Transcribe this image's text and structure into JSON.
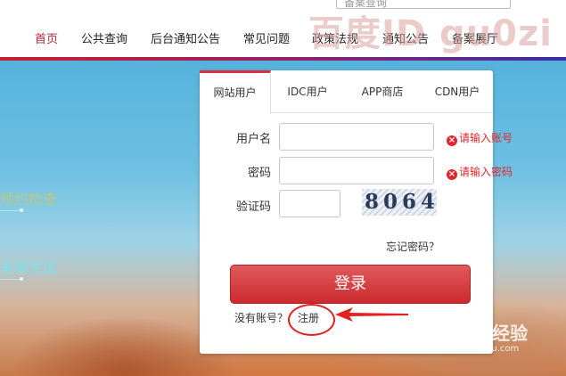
{
  "search": {
    "placeholder": "备案查询"
  },
  "nav": {
    "items": [
      {
        "label": "首页",
        "active": true
      },
      {
        "label": "公共查询"
      },
      {
        "label": "后台通知公告"
      },
      {
        "label": "常见问题"
      },
      {
        "label": "政策法规"
      },
      {
        "label": "通知公告"
      },
      {
        "label": "备案展厅"
      }
    ]
  },
  "banner": {
    "line1": "预约检查",
    "line2": "备案完成"
  },
  "login": {
    "tabs": [
      "网站用户",
      "IDC用户",
      "APP商店",
      "CDN用户"
    ],
    "username_label": "用户名",
    "username_error": "请输入账号",
    "password_label": "密码",
    "password_error": "请输入密码",
    "captcha_label": "验证码",
    "captcha_text": "8064",
    "forgot_link": "忘记密码？",
    "login_button": "登录",
    "no_account_text": "没有账号？",
    "register_link": "注册"
  },
  "watermark": {
    "top": "百度ID gu0zi",
    "bottom": "Baidu经验",
    "bottom_sub": "jingyan.baidu.com"
  },
  "colors": {
    "accent": "#d8303c",
    "error": "#e0262c",
    "annotation": "#e52020"
  }
}
